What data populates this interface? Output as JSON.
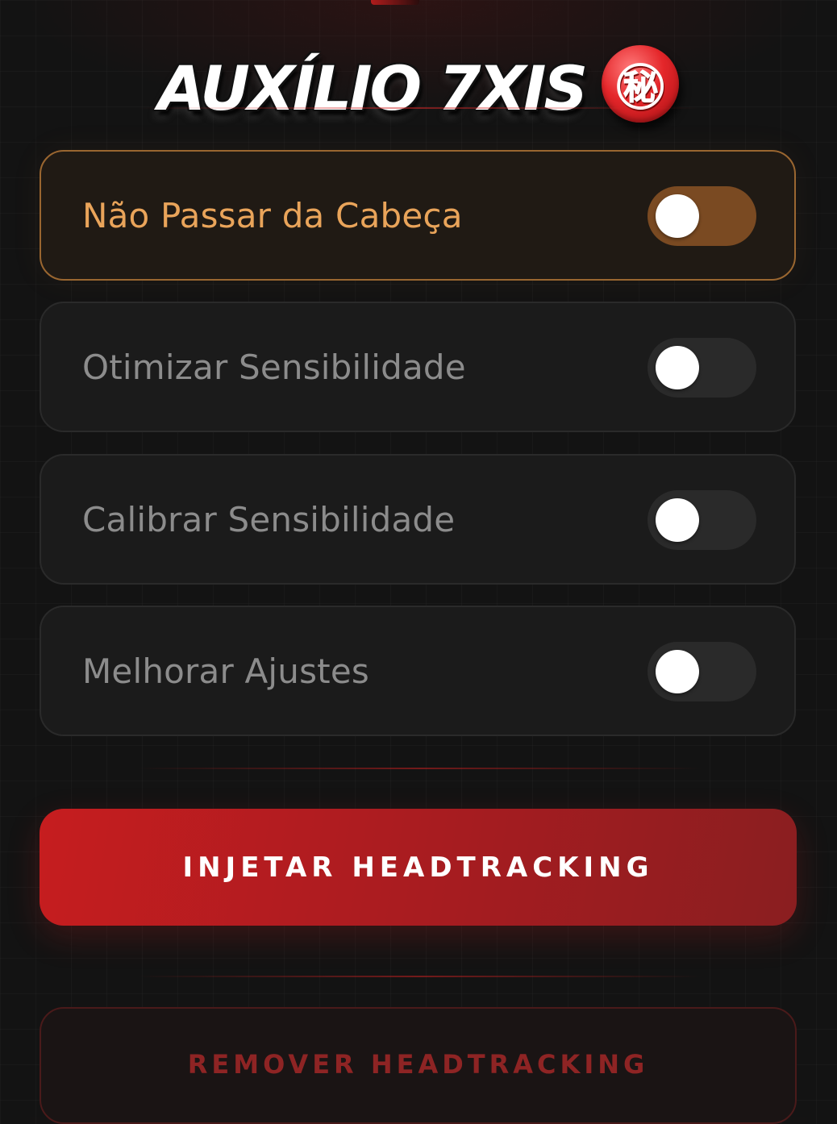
{
  "header": {
    "title": "AUXÍLIO 7XIS",
    "badge_glyph": "㊙",
    "badge_icon": "secret-seal-icon"
  },
  "options": [
    {
      "label": "Não Passar da Cabeça",
      "enabled": true
    },
    {
      "label": "Otimizar Sensibilidade",
      "enabled": false
    },
    {
      "label": "Calibrar Sensibilidade",
      "enabled": false
    },
    {
      "label": "Melhorar Ajustes",
      "enabled": false
    }
  ],
  "actions": {
    "inject_label": "INJETAR HEADTRACKING",
    "remove_label": "REMOVER HEADTRACKING"
  },
  "colors": {
    "background": "#131313",
    "accent_active": "#e9a45a",
    "toggle_on": "#7a4a22",
    "primary_red": "#c61d1f",
    "secondary_text": "#8e2424"
  }
}
